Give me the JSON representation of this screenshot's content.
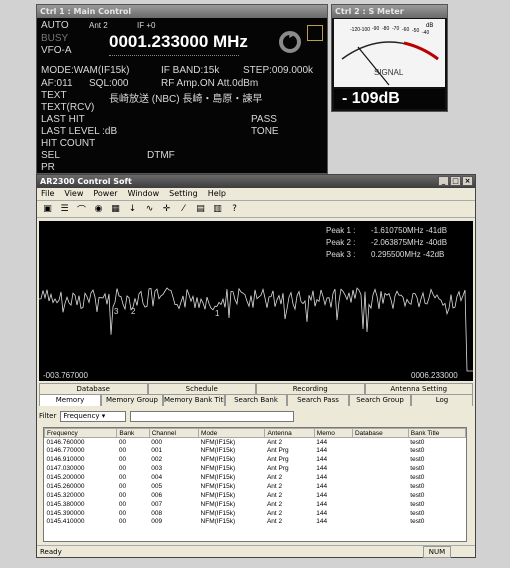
{
  "ctrl1": {
    "title": "Ctrl 1 : Main Control",
    "mode_auto": "AUTO",
    "ant": "Ant 2",
    "if_shift": "IF +0",
    "busy": "BUSY",
    "frequency": "0001.233000 MHz",
    "vfo": "VFO-A",
    "line_mode": "MODE:WAM(IF15k)",
    "line_ifband": "IF BAND:15k",
    "line_step": "STEP:009.000k",
    "line_af": "AF:011",
    "line_sql": "SQL:000",
    "line_rf": "RF Amp.ON Att.0dBm",
    "text_label": "TEXT",
    "text_value": "長崎放送 (NBC) 長崎・島原・諫早",
    "text_rcv": "TEXT(RCV)",
    "last_hit": "LAST HIT",
    "pass": "PASS",
    "last_level": "LAST LEVEL :dB",
    "tone": "TONE",
    "hit_count": "HIT COUNT",
    "sel": "SEL",
    "dtmf": "DTMF",
    "pr": "PR"
  },
  "ctrl2": {
    "title": "Ctrl 2 : S Meter",
    "unit": "dB",
    "scale": [
      "-120",
      "-100",
      "-90",
      "-80",
      "-70",
      "-60",
      "-50",
      "-40"
    ],
    "signal": "SIGNAL",
    "reading": "- 109dB"
  },
  "app": {
    "title": "AR2300 Control Soft",
    "menu": [
      "File",
      "View",
      "Power",
      "Window",
      "Setting",
      "Help"
    ],
    "toolbar_icons": [
      "save-icon",
      "list-icon",
      "antenna-icon",
      "speaker-icon",
      "scan-icon",
      "tune-icon",
      "wave-icon",
      "step-icon",
      "zoom-icon",
      "memory-icon",
      "grid-icon",
      "help-icon"
    ],
    "peaks": [
      {
        "label": "Peak 1 :",
        "value": "-1.610750MHz -41dB"
      },
      {
        "label": "Peak 2 :",
        "value": "-2.063875MHz -40dB"
      },
      {
        "label": "Peak 3 :",
        "value": "0.295500MHz -42dB"
      }
    ],
    "span_left": "-003.767000",
    "span_right": "0006.233000",
    "tabs_top": [
      "Database",
      "Schedule",
      "Recording",
      "Antenna Setting"
    ],
    "tabs_bottom": [
      "Memory",
      "Memory Group",
      "Memory Bank Title",
      "Search Bank",
      "Search Pass",
      "Search Group",
      "Log"
    ],
    "filter_label": "Filter",
    "filter_value": "Frequency",
    "columns": [
      "Frequency",
      "Bank",
      "Channel",
      "Mode",
      "Antenna",
      "Memo",
      "Database",
      "Bank Title"
    ],
    "rows": [
      [
        "0146.760000",
        "00",
        "000",
        "NFM(IF15k)",
        "Ant 2",
        "144",
        "",
        "test0"
      ],
      [
        "0146.770000",
        "00",
        "001",
        "NFM(IF15k)",
        "Ant Prg",
        "144",
        "",
        "test0"
      ],
      [
        "0146.910000",
        "00",
        "002",
        "NFM(IF15k)",
        "Ant Prg",
        "144",
        "",
        "test0"
      ],
      [
        "0147.030000",
        "00",
        "003",
        "NFM(IF15k)",
        "Ant Prg",
        "144",
        "",
        "test0"
      ],
      [
        "0145.200000",
        "00",
        "004",
        "NFM(IF15k)",
        "Ant 2",
        "144",
        "",
        "test0"
      ],
      [
        "0145.260000",
        "00",
        "005",
        "NFM(IF15k)",
        "Ant 2",
        "144",
        "",
        "test0"
      ],
      [
        "0145.320000",
        "00",
        "006",
        "NFM(IF15k)",
        "Ant 2",
        "144",
        "",
        "test0"
      ],
      [
        "0145.380000",
        "00",
        "007",
        "NFM(IF15k)",
        "Ant 2",
        "144",
        "",
        "test0"
      ],
      [
        "0145.390000",
        "00",
        "008",
        "NFM(IF15k)",
        "Ant 2",
        "144",
        "",
        "test0"
      ],
      [
        "0145.410000",
        "00",
        "009",
        "NFM(IF15k)",
        "Ant 2",
        "144",
        "",
        "test0"
      ]
    ],
    "status": "Ready",
    "num": "NUM"
  }
}
